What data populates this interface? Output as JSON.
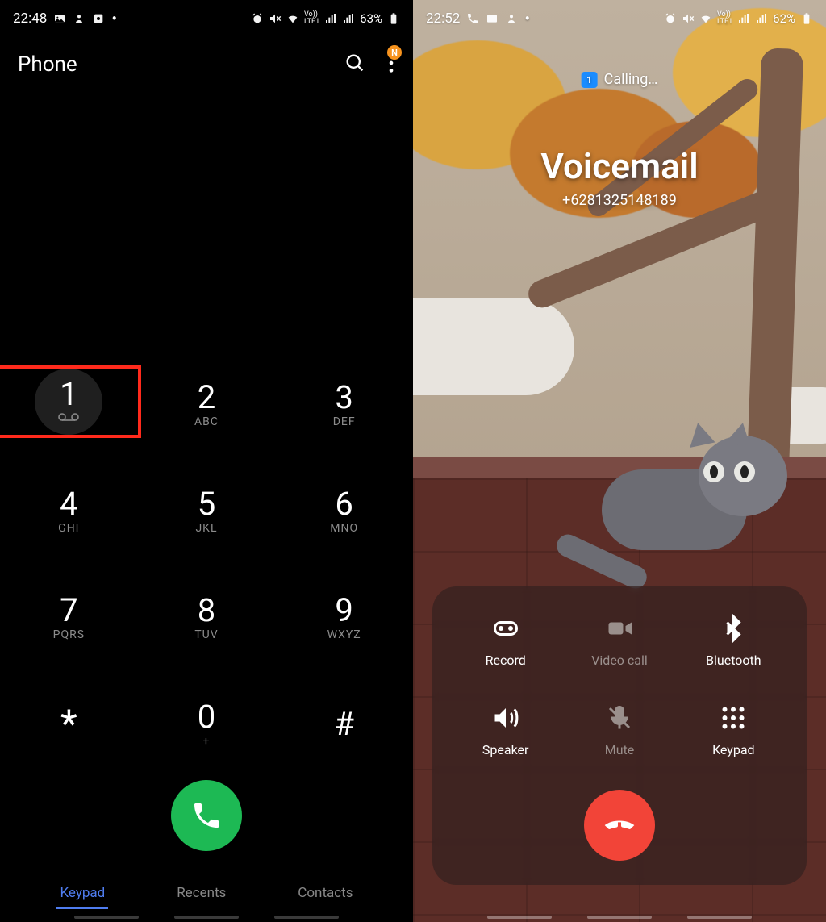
{
  "left": {
    "status": {
      "time": "22:48",
      "battery": "63%"
    },
    "header": {
      "title": "Phone",
      "badge": "N"
    },
    "keys": [
      {
        "num": "1",
        "sub": ""
      },
      {
        "num": "2",
        "sub": "ABC"
      },
      {
        "num": "3",
        "sub": "DEF"
      },
      {
        "num": "4",
        "sub": "GHI"
      },
      {
        "num": "5",
        "sub": "JKL"
      },
      {
        "num": "6",
        "sub": "MNO"
      },
      {
        "num": "7",
        "sub": "PQRS"
      },
      {
        "num": "8",
        "sub": "TUV"
      },
      {
        "num": "9",
        "sub": "WXYZ"
      },
      {
        "num": "*",
        "sub": ""
      },
      {
        "num": "0",
        "sub": "+"
      },
      {
        "num": "#",
        "sub": ""
      }
    ],
    "tabs": {
      "keypad": "Keypad",
      "recents": "Recents",
      "contacts": "Contacts"
    }
  },
  "right": {
    "status": {
      "time": "22:52",
      "battery": "62%"
    },
    "calling_label": "Calling…",
    "sim": "1",
    "callee_name": "Voicemail",
    "callee_number": "+6281325148189",
    "controls": {
      "record": "Record",
      "video": "Video call",
      "bluetooth": "Bluetooth",
      "speaker": "Speaker",
      "mute": "Mute",
      "keypad": "Keypad"
    }
  }
}
